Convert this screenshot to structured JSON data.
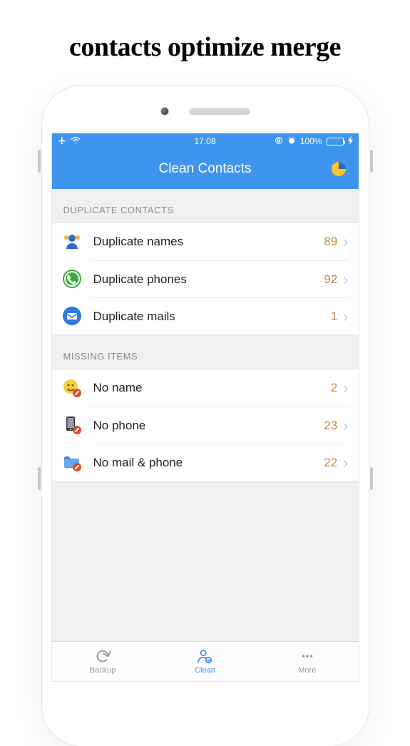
{
  "promo_title": "contacts optimize merge",
  "status": {
    "time": "17:08",
    "battery_pct": "100%"
  },
  "nav": {
    "title": "Clean Contacts"
  },
  "sections": [
    {
      "header": "DUPLICATE CONTACTS",
      "rows": [
        {
          "label": "Duplicate names",
          "count": "89"
        },
        {
          "label": "Duplicate phones",
          "count": "92"
        },
        {
          "label": "Duplicate mails",
          "count": "1"
        }
      ]
    },
    {
      "header": "MISSING ITEMS",
      "rows": [
        {
          "label": "No name",
          "count": "2"
        },
        {
          "label": "No phone",
          "count": "23"
        },
        {
          "label": "No mail & phone",
          "count": "22"
        }
      ]
    }
  ],
  "tabs": {
    "backup": "Backup",
    "clean": "Clean",
    "more": "More"
  }
}
